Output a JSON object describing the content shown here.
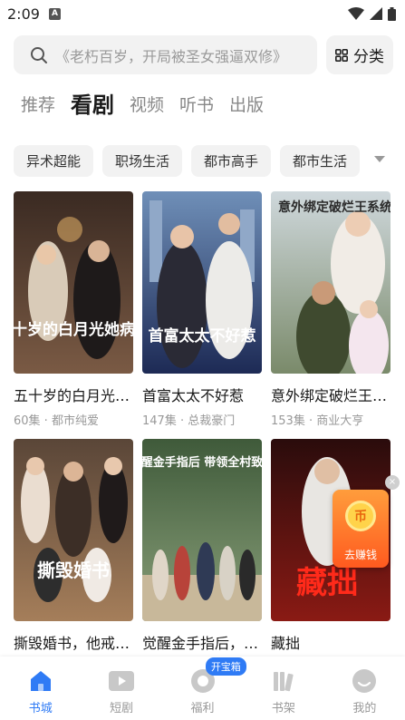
{
  "status_bar": {
    "time": "2:09",
    "notification_glyph": "A"
  },
  "search": {
    "placeholder": "《老朽百岁，开局被圣女强逼双修》",
    "classify_label": "分类"
  },
  "tabs": [
    {
      "label": "推荐",
      "active": false
    },
    {
      "label": "看剧",
      "active": true
    },
    {
      "label": "视频",
      "active": false
    },
    {
      "label": "听书",
      "active": false
    },
    {
      "label": "出版",
      "active": false
    }
  ],
  "chips": [
    "异术超能",
    "职场生活",
    "都市高手",
    "都市生活"
  ],
  "books": [
    {
      "title": "五十岁的白月光她病了",
      "meta": "60集 · 都市纯爱",
      "cover_text": "五十岁的白月光她病了"
    },
    {
      "title": "首富太太不好惹",
      "meta": "147集 · 总裁豪门",
      "cover_text": "首富太太不好惹"
    },
    {
      "title": "意外绑定破烂王系统",
      "meta": "153集 · 商业大亨",
      "cover_text": "意外绑定破烂王系统"
    },
    {
      "title": "撕毁婚书，他戒掉了恋爱脑",
      "meta": "",
      "cover_text": "撕毁婚书"
    },
    {
      "title": "觉醒金手指后，带领全村致富",
      "meta": "",
      "cover_text": "觉醒金手指后 带领全村致富"
    },
    {
      "title": "藏拙",
      "meta": "",
      "cover_text": "藏拙"
    }
  ],
  "reward_widget": {
    "coin_label": "币",
    "label": "去赚钱"
  },
  "bottom_nav": [
    {
      "label": "书城",
      "icon": "bookstore-icon",
      "active": true
    },
    {
      "label": "短剧",
      "icon": "short-drama-icon",
      "active": false
    },
    {
      "label": "福利",
      "icon": "welfare-icon",
      "active": false,
      "badge": "开宝箱"
    },
    {
      "label": "书架",
      "icon": "bookshelf-icon",
      "active": false
    },
    {
      "label": "我的",
      "icon": "profile-icon",
      "active": false
    }
  ],
  "colors": {
    "accent": "#2f7bf5",
    "reward": "#ff7a2a"
  }
}
